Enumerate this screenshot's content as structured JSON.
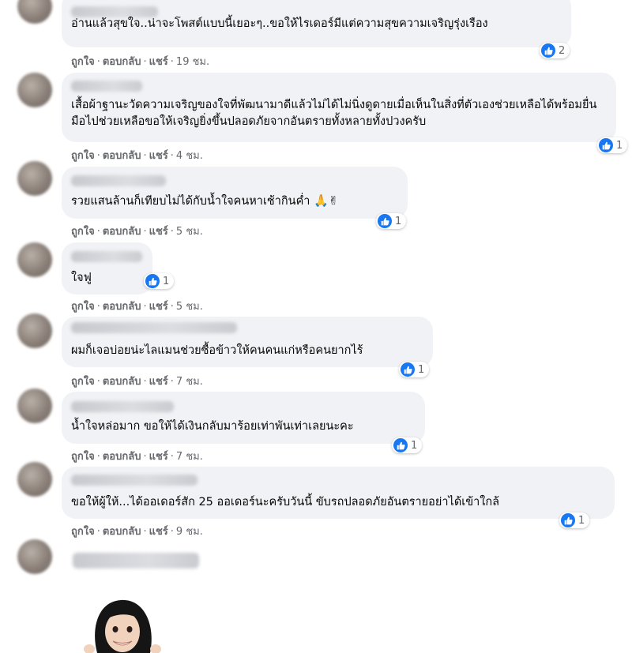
{
  "actions": {
    "like": "ถูกใจ",
    "reply": "ตอบกลับ",
    "share": "แชร์",
    "dot": "·"
  },
  "comments": [
    {
      "text": "อ่านแล้วสุขใจ..น่าจะโพสต์แบบนี้เยอะๆ..ขอให้ไรเดอร์มีแต่ความสุขความเจริญรุ่งเรือง",
      "reactions": "2",
      "time": "19 ชม."
    },
    {
      "text": "เสื้อผ้าฐานะวัดความเจริญของใจที่พัฒนามาดีแล้วไม่ได้ไม่นิ่งดูดายเมื่อเห็นในสิ่งที่ตัวเองช่วยเหลือได้พร้อมยื่นมือไปช่วยเหลือขอให้เจริญยิ่งขึ้นปลอดภัยจากอันตรายทั้งหลายทั้งปวงครับ",
      "reactions": "1",
      "time": "4 ชม."
    },
    {
      "text": "รวยแสนล้านก็เทียบไม่ได้กับน้ำใจคนหาเช้ากินค่ำ",
      "emoji": "🙏✌",
      "reactions": "1",
      "time": "5 ชม."
    },
    {
      "text": "ใจฟู",
      "reactions": "1",
      "time": "5 ชม."
    },
    {
      "text": "ผมก็เจอบ่อยน่ะไลแมนช่วยซื้อข้าวให้คนคนแก่หรือคนยากไร้",
      "reactions": "1",
      "time": "7 ชม."
    },
    {
      "text": "น้ำใจหล่อมาก ขอให้ได้เงินกลับมาร้อยเท่าพันเท่าเลยนะคะ",
      "reactions": "1",
      "time": "7 ชม."
    },
    {
      "text": "ขอให้ผู้ให้...ได้ออเดอร์สัก 25 ออเดอร์นะครับวันนี้ ขับรถปลอดภัยอันตรายอย่าได้เข้าใกล้",
      "reactions": "1",
      "time": "9 ชม."
    }
  ],
  "colors": {
    "bubble": "#f0f2f5",
    "like_blue": "#1877f2",
    "meta": "#65676b"
  }
}
